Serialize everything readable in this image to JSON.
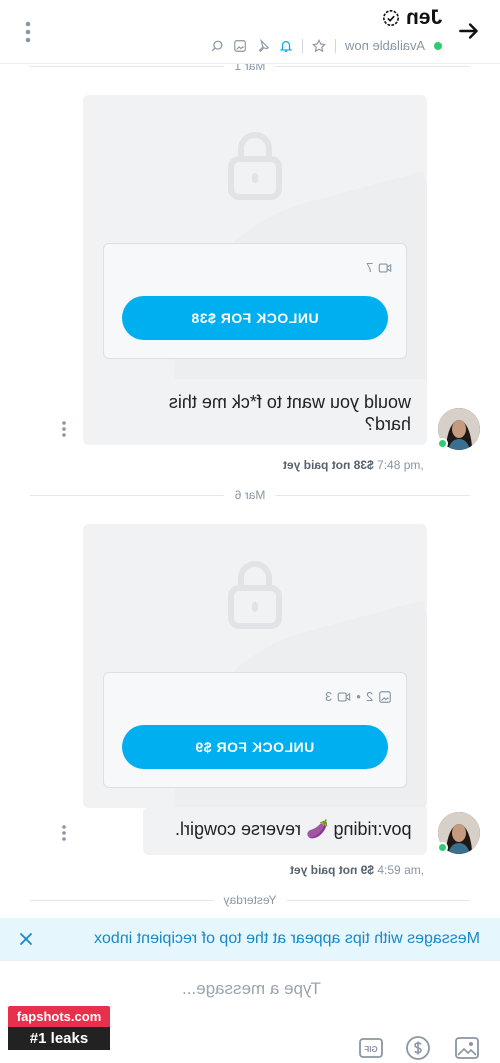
{
  "header": {
    "title": "Jen",
    "status": "Available now",
    "back_icon": "arrow-right-icon",
    "menu_icon": "vertical-dots-icon"
  },
  "dividers": {
    "first": "Mar 1",
    "second": "Mar 6",
    "third": "Yesterday"
  },
  "messages": [
    {
      "media_count": "7",
      "unlock_label": "UNLOCK FOR $38",
      "text": "would you want to f*ck me this hard?",
      "time": "7:48 pm,",
      "price_status": "$38 not paid yet"
    },
    {
      "photo_count": "2",
      "video_count": "3",
      "unlock_label": "UNLOCK FOR $9",
      "text": "pov:riding 🍆 reverse cowgirl.",
      "time": "4:59 am,",
      "price_status": "$9 not paid yet"
    }
  ],
  "tips_banner": {
    "text": "Messages with tips appear at the top of recipient inbox"
  },
  "composer": {
    "placeholder": "Type a message..."
  },
  "watermark": {
    "line1": "fapshots.com",
    "line2": "#1 leaks"
  },
  "colors": {
    "accent": "#00aff0",
    "online": "#2ecc71",
    "banner_bg": "#e5f6fd"
  }
}
